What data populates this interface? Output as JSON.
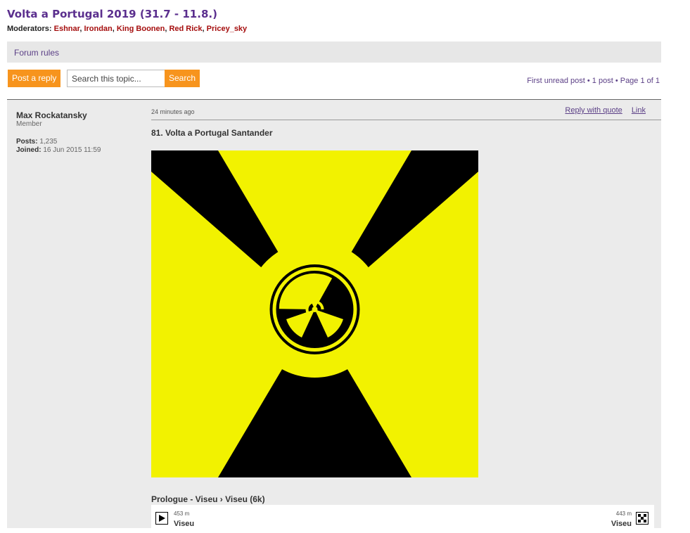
{
  "topic": {
    "title": "Volta a Portugal 2019 (31.7 - 11.8.)",
    "moderators_label": "Moderators:",
    "moderators": [
      "Eshnar",
      "Irondan",
      "King Boonen",
      "Red Rick",
      "Pricey_sky"
    ]
  },
  "rules_link": "Forum rules",
  "actions": {
    "post_reply": "Post a reply",
    "search_placeholder": "Search this topic...",
    "search_button": "Search"
  },
  "pagination": {
    "text": "First unread post • 1 post • Page 1 of 1"
  },
  "post": {
    "author": "Max Rockatansky",
    "rank": "Member",
    "posts_label": "Posts:",
    "posts_value": "1,235",
    "joined_label": "Joined:",
    "joined_value": "16 Jun 2015 11:59",
    "time": "24 minutes ago",
    "reply_with_quote": "Reply with quote",
    "link": "Link",
    "title": "81. Volta a Portugal Santander",
    "stage_title": "Prologue - Viseu › Viseu (6k)",
    "start_elev": "453 m",
    "start_town": "Viseu",
    "finish_elev": "443 m",
    "finish_town": "Viseu"
  },
  "colors": {
    "accent_orange": "#f7941d",
    "title_purple": "#5b2f8e",
    "moderator_red": "#a50e0e",
    "hazard_yellow": "#f2f200"
  }
}
